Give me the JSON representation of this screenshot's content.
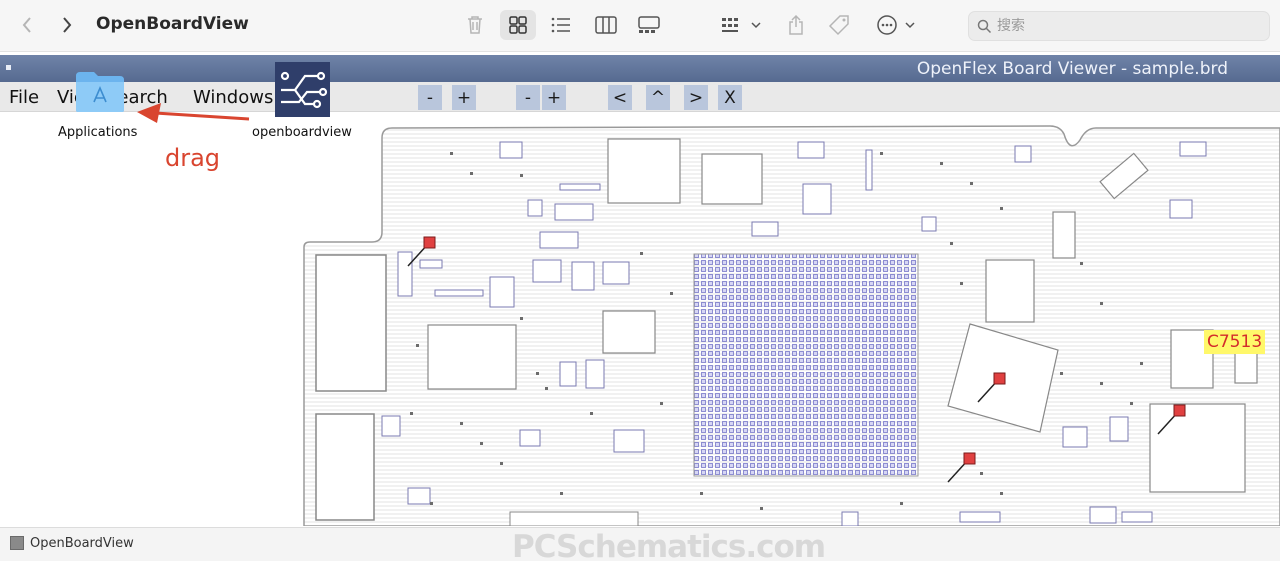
{
  "finder": {
    "title": "OpenBoardView",
    "search_placeholder": "搜索",
    "icons": [
      "chevron-left-icon",
      "chevron-right-icon",
      "trash-icon",
      "grid-view-icon",
      "list-view-icon",
      "column-view-icon",
      "gallery-view-icon",
      "group-icon",
      "share-icon",
      "tag-icon",
      "more-icon",
      "search-icon"
    ]
  },
  "viewer": {
    "title": "OpenFlex Board Viewer - sample.brd",
    "menu": [
      "File",
      "View",
      "Search",
      "Windows"
    ],
    "buttons": [
      "-",
      "+",
      "-",
      "+",
      "<",
      "^",
      ">",
      "X"
    ]
  },
  "overlay": {
    "applications_label": "Applications",
    "openboardview_label": "openboardview",
    "drag_label": "drag"
  },
  "board": {
    "component_label": "C7513",
    "colors": {
      "outline": "#9a9a9a",
      "pin": "#6a6ac8",
      "pin_fill": "#c8c8f0",
      "marker": "#e04040",
      "highlight": "#fff86a"
    }
  },
  "pathbar": {
    "label": "OpenBoardView"
  },
  "watermark": "PCSchematics.com"
}
